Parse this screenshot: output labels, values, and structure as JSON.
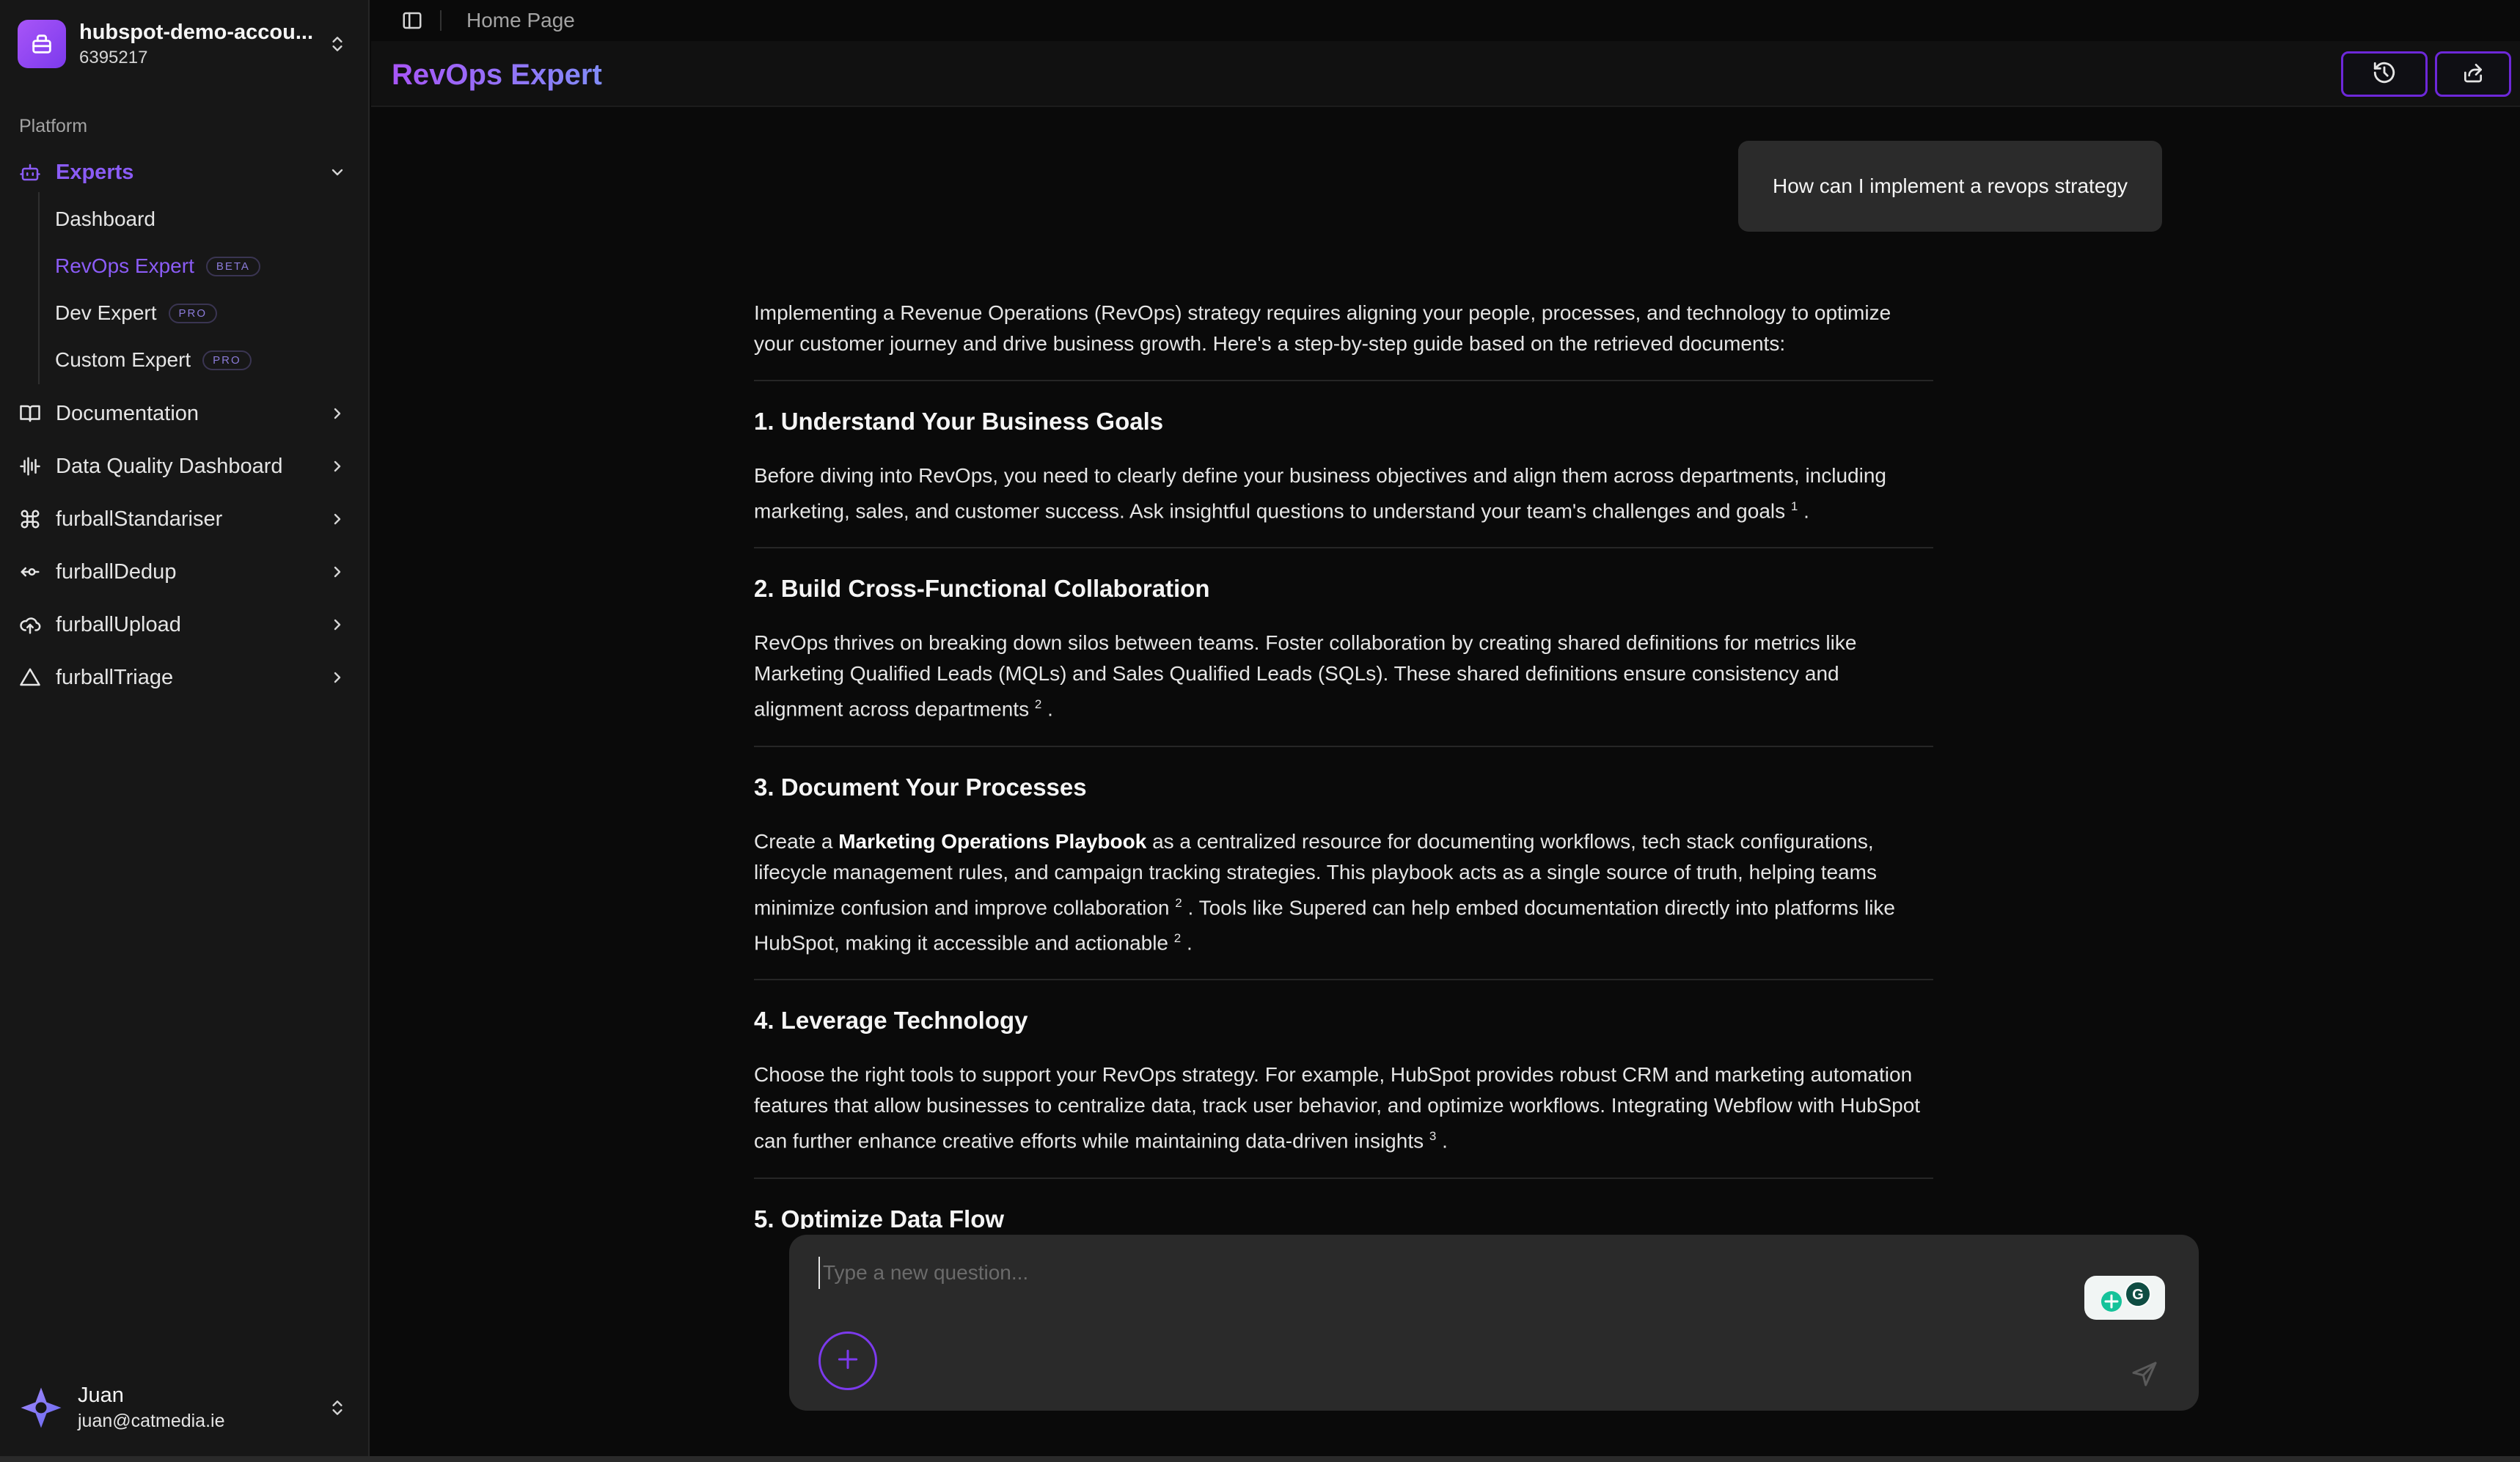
{
  "account": {
    "name": "hubspot-demo-accou...",
    "id": "6395217"
  },
  "sidebar": {
    "section_label": "Platform",
    "experts_label": "Experts",
    "subitems": [
      {
        "label": "Dashboard",
        "badge": ""
      },
      {
        "label": "RevOps Expert",
        "badge": "BETA"
      },
      {
        "label": "Dev Expert",
        "badge": "PRO"
      },
      {
        "label": "Custom Expert",
        "badge": "PRO"
      }
    ],
    "items": [
      {
        "label": "Documentation",
        "icon": "book-icon"
      },
      {
        "label": "Data Quality Dashboard",
        "icon": "waveform-icon"
      },
      {
        "label": "furballStandariser",
        "icon": "command-icon"
      },
      {
        "label": "furballDedup",
        "icon": "merge-icon"
      },
      {
        "label": "furballUpload",
        "icon": "cloud-upload-icon"
      },
      {
        "label": "furballTriage",
        "icon": "triangle-icon"
      }
    ]
  },
  "user": {
    "name": "Juan",
    "email": "juan@catmedia.ie"
  },
  "header": {
    "breadcrumb": "Home Page",
    "title": "RevOps Expert"
  },
  "chat": {
    "question": "How can I implement a revops strategy",
    "intro": "Implementing a Revenue Operations (RevOps) strategy requires aligning your people, processes, and technology to optimize your customer journey and drive business growth. Here's a step-by-step guide based on the retrieved documents:",
    "sections": [
      {
        "heading": "1. Understand Your Business Goals",
        "text": "Before diving into RevOps, you need to clearly define your business objectives and align them across departments, including marketing, sales, and customer success. Ask insightful questions to understand your team's challenges and goals",
        "ref": "1",
        "end": "."
      },
      {
        "heading": "2. Build Cross-Functional Collaboration",
        "text": "RevOps thrives on breaking down silos between teams. Foster collaboration by creating shared definitions for metrics like Marketing Qualified Leads (MQLs) and Sales Qualified Leads (SQLs). These shared definitions ensure consistency and alignment across departments",
        "ref": "2",
        "end": "."
      },
      {
        "heading": "3. Document Your Processes",
        "text_a": "Create a",
        "bold": "Marketing Operations Playbook",
        "text_b": "as a centralized resource for documenting workflows, tech stack configurations, lifecycle management rules, and campaign tracking strategies. This playbook acts as a single source of truth, helping teams minimize confusion and improve collaboration",
        "ref_a": "2",
        "text_c": ". Tools like Supered can help embed documentation directly into platforms like HubSpot, making it accessible and actionable",
        "ref_b": "2",
        "end": "."
      },
      {
        "heading": "4. Leverage Technology",
        "text": "Choose the right tools to support your RevOps strategy. For example, HubSpot provides robust CRM and marketing automation features that allow businesses to centralize data, track user behavior, and optimize workflows. Integrating Webflow with HubSpot can further enhance creative efforts while maintaining data-driven insights",
        "ref": "3",
        "end": "."
      },
      {
        "heading": "5. Optimize Data Flow"
      }
    ]
  },
  "composer": {
    "placeholder": "Type a new question..."
  },
  "colors": {
    "accent": "#7c3aed",
    "accent_light": "#8b5cf6",
    "background": "#0a0a0a",
    "sidebar": "#171717"
  },
  "icons": {
    "history": "history-icon",
    "share": "share-icon",
    "sidebar_toggle": "sidebar-toggle-icon",
    "add": "plus-icon",
    "send": "send-icon",
    "grammarly": "grammarly-icon"
  }
}
